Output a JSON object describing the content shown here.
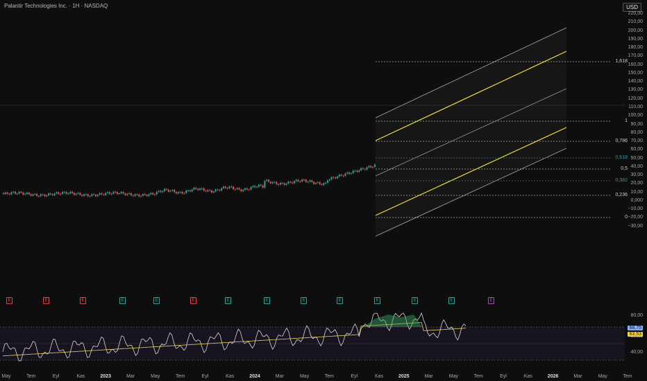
{
  "header": {
    "title": "Palantir Technologies Inc. · 1H · NASDAQ",
    "currency": "USD"
  },
  "price_axis": [
    "220,00",
    "210,00",
    "200,00",
    "190,00",
    "180,00",
    "170,00",
    "160,00",
    "150,00",
    "140,00",
    "130,00",
    "120,00",
    "110,00",
    "100,00",
    "90,00",
    "80,00",
    "70,00",
    "60,00",
    "50,00",
    "40,00",
    "30,00",
    "20,00",
    "10,00",
    "0,000",
    "−10,00",
    "−20,00",
    "−30,00"
  ],
  "fib_levels": [
    {
      "label": "1,618",
      "color": "#d0d0d0"
    },
    {
      "label": "1",
      "color": "#d0d0d0"
    },
    {
      "label": "0,786",
      "color": "#d0d0d0"
    },
    {
      "label": "0,618",
      "color": "#2a9da8"
    },
    {
      "label": "0,5",
      "color": "#d0d0d0"
    },
    {
      "label": "0,382",
      "color": "#2a9da8"
    },
    {
      "label": "0,236",
      "color": "#d0d0d0"
    },
    {
      "label": "0",
      "color": "#d0d0d0"
    }
  ],
  "events": [
    {
      "label": "E",
      "color": "#e04545"
    },
    {
      "label": "E",
      "color": "#e04545"
    },
    {
      "label": "E",
      "color": "#e04545"
    },
    {
      "label": "E",
      "color": "#26a69a"
    },
    {
      "label": "E",
      "color": "#26a69a"
    },
    {
      "label": "E",
      "color": "#e04545"
    },
    {
      "label": "E",
      "color": "#26a69a"
    },
    {
      "label": "E",
      "color": "#26a69a"
    },
    {
      "label": "E",
      "color": "#26a69a"
    },
    {
      "label": "E",
      "color": "#26a69a"
    },
    {
      "label": "E",
      "color": "#26a69a"
    },
    {
      "label": "E",
      "color": "#26a69a"
    },
    {
      "label": "E",
      "color": "#26a69a"
    },
    {
      "label": "E",
      "color": "#b040d0"
    }
  ],
  "rsi": {
    "axis": [
      "80,00",
      "60,00",
      "40,00"
    ],
    "value": "68,75",
    "ma_value": "63,53",
    "value_color": "#8ab4f8",
    "ma_color": "#f5d742"
  },
  "time_axis": [
    {
      "label": "May",
      "bold": false
    },
    {
      "label": "Tem",
      "bold": false
    },
    {
      "label": "Eyl",
      "bold": false
    },
    {
      "label": "Kas",
      "bold": false
    },
    {
      "label": "2023",
      "bold": true
    },
    {
      "label": "Mar",
      "bold": false
    },
    {
      "label": "May",
      "bold": false
    },
    {
      "label": "Tem",
      "bold": false
    },
    {
      "label": "Eyl",
      "bold": false
    },
    {
      "label": "Kas",
      "bold": false
    },
    {
      "label": "2024",
      "bold": true
    },
    {
      "label": "Mar",
      "bold": false
    },
    {
      "label": "May",
      "bold": false
    },
    {
      "label": "Tem",
      "bold": false
    },
    {
      "label": "Eyl",
      "bold": false
    },
    {
      "label": "Kas",
      "bold": false
    },
    {
      "label": "2025",
      "bold": true
    },
    {
      "label": "Mar",
      "bold": false
    },
    {
      "label": "May",
      "bold": false
    },
    {
      "label": "Tem",
      "bold": false
    },
    {
      "label": "Eyl",
      "bold": false
    },
    {
      "label": "Kas",
      "bold": false
    },
    {
      "label": "2026",
      "bold": true
    },
    {
      "label": "Mar",
      "bold": false
    },
    {
      "label": "May",
      "bold": false
    },
    {
      "label": "Tem",
      "bold": false
    }
  ],
  "colors": {
    "up": "#26a69a",
    "down": "#ef5350",
    "channel_mid": "#f0e040",
    "channel_outer": "#cfcfcf",
    "rsi_line": "#d8d8d8",
    "rsi_ma": "#d4c34a"
  }
}
